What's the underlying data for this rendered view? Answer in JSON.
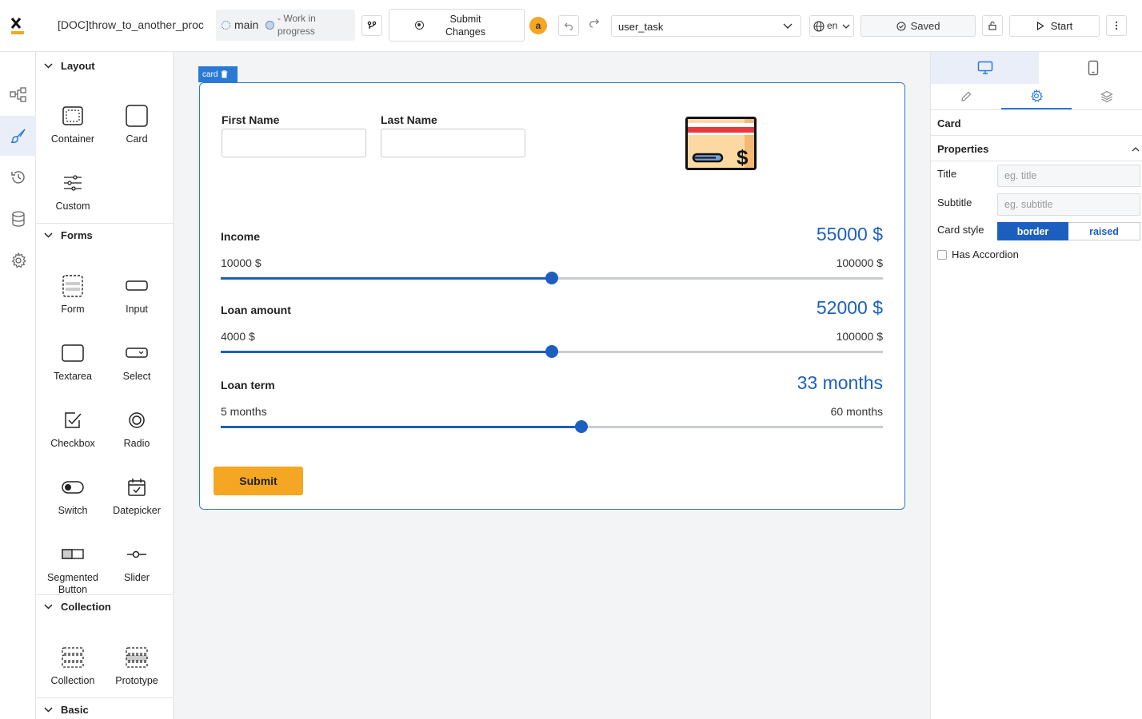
{
  "header": {
    "doc_title": "[DOC]throw_to_another_proc",
    "branch": "main",
    "branch_status": "- Work in progress",
    "submit_changes": "Submit Changes",
    "avatar_letter": "a",
    "selected_task": "user_task",
    "language": "en",
    "saved_label": "Saved",
    "start_label": "Start"
  },
  "palette": {
    "sections": {
      "layout": "Layout",
      "forms": "Forms",
      "collection": "Collection",
      "basic": "Basic"
    },
    "items": {
      "container": "Container",
      "card": "Card",
      "custom": "Custom",
      "form": "Form",
      "input": "Input",
      "textarea": "Textarea",
      "select": "Select",
      "checkbox": "Checkbox",
      "radio": "Radio",
      "switch": "Switch",
      "datepicker": "Datepicker",
      "segmented_button_1": "Segmented",
      "segmented_button_2": "Button",
      "slider": "Slider",
      "collection": "Collection",
      "prototype": "Prototype"
    }
  },
  "canvas": {
    "card_tag": "card",
    "first_name_label": "First Name",
    "last_name_label": "Last Name",
    "sliders": [
      {
        "label": "Income",
        "value": "55000 $",
        "min": "10000 $",
        "max": "100000 $",
        "fraction": 0.5
      },
      {
        "label": "Loan amount",
        "value": "52000 $",
        "min": "4000 $",
        "max": "100000 $",
        "fraction": 0.5
      },
      {
        "label": "Loan term",
        "value": "33 months",
        "min": "5 months",
        "max": "60 months",
        "fraction": 0.545
      }
    ],
    "submit_label": "Submit"
  },
  "right_panel": {
    "component_name": "Card",
    "properties_title": "Properties",
    "title_label": "Title",
    "title_placeholder": "eg. title",
    "subtitle_label": "Subtitle",
    "subtitle_placeholder": "eg. subtitle",
    "card_style_label": "Card style",
    "card_style_options": [
      "border",
      "raised"
    ],
    "card_style_selected": "border",
    "has_accordion_label": "Has Accordion"
  },
  "colors": {
    "accent": "#1d5fbf",
    "brand_orange": "#f5a623",
    "selection": "#2a79d6"
  }
}
